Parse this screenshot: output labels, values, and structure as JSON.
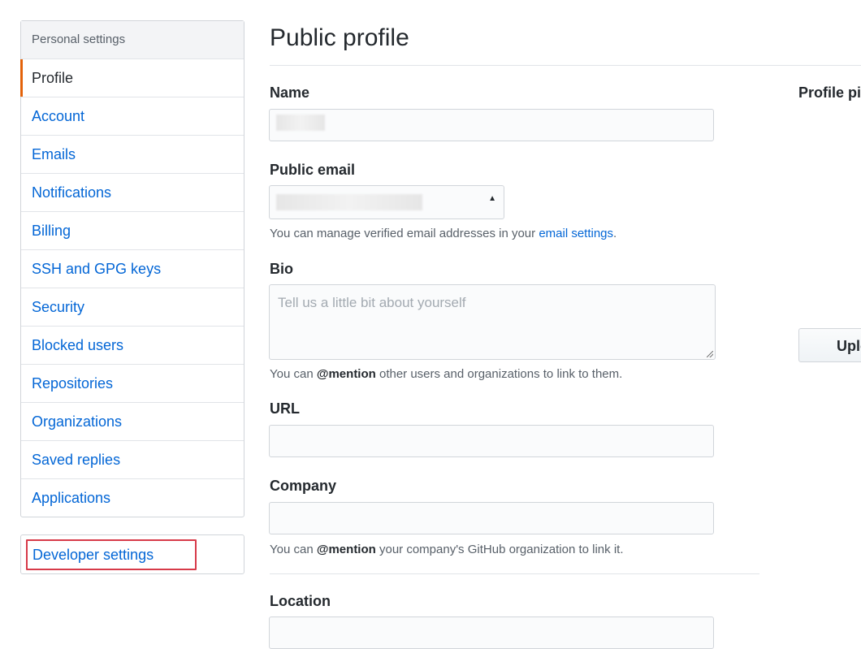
{
  "sidebar": {
    "header": "Personal settings",
    "items": [
      {
        "label": "Profile",
        "active": true
      },
      {
        "label": "Account"
      },
      {
        "label": "Emails"
      },
      {
        "label": "Notifications"
      },
      {
        "label": "Billing"
      },
      {
        "label": "SSH and GPG keys"
      },
      {
        "label": "Security"
      },
      {
        "label": "Blocked users"
      },
      {
        "label": "Repositories"
      },
      {
        "label": "Organizations"
      },
      {
        "label": "Saved replies"
      },
      {
        "label": "Applications"
      }
    ],
    "developer_settings": "Developer settings"
  },
  "main": {
    "title": "Public profile",
    "name": {
      "label": "Name"
    },
    "public_email": {
      "label": "Public email",
      "note_prefix": "You can manage verified email addresses in your ",
      "note_link": "email settings",
      "note_suffix": "."
    },
    "bio": {
      "label": "Bio",
      "placeholder": "Tell us a little bit about yourself",
      "note_prefix": "You can ",
      "note_mention": "@mention",
      "note_suffix": " other users and organizations to link to them."
    },
    "url": {
      "label": "URL"
    },
    "company": {
      "label": "Company",
      "note_prefix": "You can ",
      "note_mention": "@mention",
      "note_suffix": " your company's GitHub organization to link it."
    },
    "location": {
      "label": "Location"
    }
  },
  "profile_picture": {
    "label": "Profile pic",
    "upload_label": "Uplo"
  },
  "colors": {
    "link": "#0366d6",
    "active_marker": "#e36209",
    "highlight_box": "#d73a49"
  }
}
